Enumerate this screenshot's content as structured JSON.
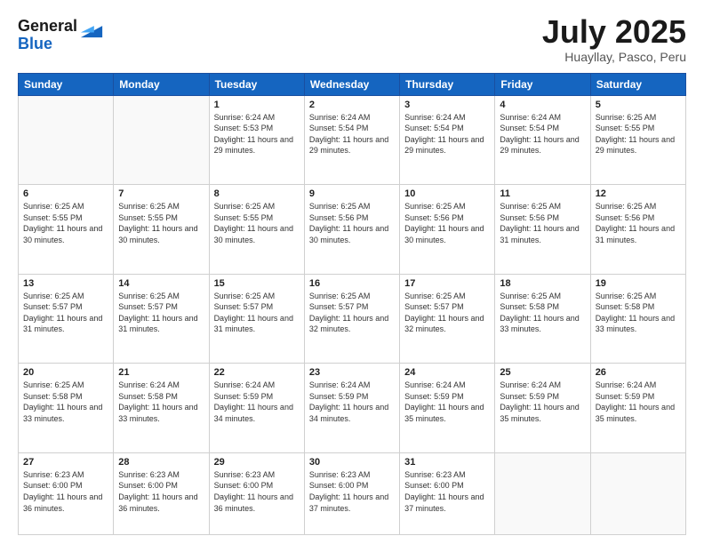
{
  "header": {
    "logo_line1": "General",
    "logo_line2": "Blue",
    "month_year": "July 2025",
    "location": "Huayllay, Pasco, Peru"
  },
  "weekdays": [
    "Sunday",
    "Monday",
    "Tuesday",
    "Wednesday",
    "Thursday",
    "Friday",
    "Saturday"
  ],
  "weeks": [
    [
      {
        "day": "",
        "sunrise": "",
        "sunset": "",
        "daylight": ""
      },
      {
        "day": "",
        "sunrise": "",
        "sunset": "",
        "daylight": ""
      },
      {
        "day": "1",
        "sunrise": "Sunrise: 6:24 AM",
        "sunset": "Sunset: 5:53 PM",
        "daylight": "Daylight: 11 hours and 29 minutes."
      },
      {
        "day": "2",
        "sunrise": "Sunrise: 6:24 AM",
        "sunset": "Sunset: 5:54 PM",
        "daylight": "Daylight: 11 hours and 29 minutes."
      },
      {
        "day": "3",
        "sunrise": "Sunrise: 6:24 AM",
        "sunset": "Sunset: 5:54 PM",
        "daylight": "Daylight: 11 hours and 29 minutes."
      },
      {
        "day": "4",
        "sunrise": "Sunrise: 6:24 AM",
        "sunset": "Sunset: 5:54 PM",
        "daylight": "Daylight: 11 hours and 29 minutes."
      },
      {
        "day": "5",
        "sunrise": "Sunrise: 6:25 AM",
        "sunset": "Sunset: 5:55 PM",
        "daylight": "Daylight: 11 hours and 29 minutes."
      }
    ],
    [
      {
        "day": "6",
        "sunrise": "Sunrise: 6:25 AM",
        "sunset": "Sunset: 5:55 PM",
        "daylight": "Daylight: 11 hours and 30 minutes."
      },
      {
        "day": "7",
        "sunrise": "Sunrise: 6:25 AM",
        "sunset": "Sunset: 5:55 PM",
        "daylight": "Daylight: 11 hours and 30 minutes."
      },
      {
        "day": "8",
        "sunrise": "Sunrise: 6:25 AM",
        "sunset": "Sunset: 5:55 PM",
        "daylight": "Daylight: 11 hours and 30 minutes."
      },
      {
        "day": "9",
        "sunrise": "Sunrise: 6:25 AM",
        "sunset": "Sunset: 5:56 PM",
        "daylight": "Daylight: 11 hours and 30 minutes."
      },
      {
        "day": "10",
        "sunrise": "Sunrise: 6:25 AM",
        "sunset": "Sunset: 5:56 PM",
        "daylight": "Daylight: 11 hours and 30 minutes."
      },
      {
        "day": "11",
        "sunrise": "Sunrise: 6:25 AM",
        "sunset": "Sunset: 5:56 PM",
        "daylight": "Daylight: 11 hours and 31 minutes."
      },
      {
        "day": "12",
        "sunrise": "Sunrise: 6:25 AM",
        "sunset": "Sunset: 5:56 PM",
        "daylight": "Daylight: 11 hours and 31 minutes."
      }
    ],
    [
      {
        "day": "13",
        "sunrise": "Sunrise: 6:25 AM",
        "sunset": "Sunset: 5:57 PM",
        "daylight": "Daylight: 11 hours and 31 minutes."
      },
      {
        "day": "14",
        "sunrise": "Sunrise: 6:25 AM",
        "sunset": "Sunset: 5:57 PM",
        "daylight": "Daylight: 11 hours and 31 minutes."
      },
      {
        "day": "15",
        "sunrise": "Sunrise: 6:25 AM",
        "sunset": "Sunset: 5:57 PM",
        "daylight": "Daylight: 11 hours and 31 minutes."
      },
      {
        "day": "16",
        "sunrise": "Sunrise: 6:25 AM",
        "sunset": "Sunset: 5:57 PM",
        "daylight": "Daylight: 11 hours and 32 minutes."
      },
      {
        "day": "17",
        "sunrise": "Sunrise: 6:25 AM",
        "sunset": "Sunset: 5:57 PM",
        "daylight": "Daylight: 11 hours and 32 minutes."
      },
      {
        "day": "18",
        "sunrise": "Sunrise: 6:25 AM",
        "sunset": "Sunset: 5:58 PM",
        "daylight": "Daylight: 11 hours and 33 minutes."
      },
      {
        "day": "19",
        "sunrise": "Sunrise: 6:25 AM",
        "sunset": "Sunset: 5:58 PM",
        "daylight": "Daylight: 11 hours and 33 minutes."
      }
    ],
    [
      {
        "day": "20",
        "sunrise": "Sunrise: 6:25 AM",
        "sunset": "Sunset: 5:58 PM",
        "daylight": "Daylight: 11 hours and 33 minutes."
      },
      {
        "day": "21",
        "sunrise": "Sunrise: 6:24 AM",
        "sunset": "Sunset: 5:58 PM",
        "daylight": "Daylight: 11 hours and 33 minutes."
      },
      {
        "day": "22",
        "sunrise": "Sunrise: 6:24 AM",
        "sunset": "Sunset: 5:59 PM",
        "daylight": "Daylight: 11 hours and 34 minutes."
      },
      {
        "day": "23",
        "sunrise": "Sunrise: 6:24 AM",
        "sunset": "Sunset: 5:59 PM",
        "daylight": "Daylight: 11 hours and 34 minutes."
      },
      {
        "day": "24",
        "sunrise": "Sunrise: 6:24 AM",
        "sunset": "Sunset: 5:59 PM",
        "daylight": "Daylight: 11 hours and 35 minutes."
      },
      {
        "day": "25",
        "sunrise": "Sunrise: 6:24 AM",
        "sunset": "Sunset: 5:59 PM",
        "daylight": "Daylight: 11 hours and 35 minutes."
      },
      {
        "day": "26",
        "sunrise": "Sunrise: 6:24 AM",
        "sunset": "Sunset: 5:59 PM",
        "daylight": "Daylight: 11 hours and 35 minutes."
      }
    ],
    [
      {
        "day": "27",
        "sunrise": "Sunrise: 6:23 AM",
        "sunset": "Sunset: 6:00 PM",
        "daylight": "Daylight: 11 hours and 36 minutes."
      },
      {
        "day": "28",
        "sunrise": "Sunrise: 6:23 AM",
        "sunset": "Sunset: 6:00 PM",
        "daylight": "Daylight: 11 hours and 36 minutes."
      },
      {
        "day": "29",
        "sunrise": "Sunrise: 6:23 AM",
        "sunset": "Sunset: 6:00 PM",
        "daylight": "Daylight: 11 hours and 36 minutes."
      },
      {
        "day": "30",
        "sunrise": "Sunrise: 6:23 AM",
        "sunset": "Sunset: 6:00 PM",
        "daylight": "Daylight: 11 hours and 37 minutes."
      },
      {
        "day": "31",
        "sunrise": "Sunrise: 6:23 AM",
        "sunset": "Sunset: 6:00 PM",
        "daylight": "Daylight: 11 hours and 37 minutes."
      },
      {
        "day": "",
        "sunrise": "",
        "sunset": "",
        "daylight": ""
      },
      {
        "day": "",
        "sunrise": "",
        "sunset": "",
        "daylight": ""
      }
    ]
  ]
}
